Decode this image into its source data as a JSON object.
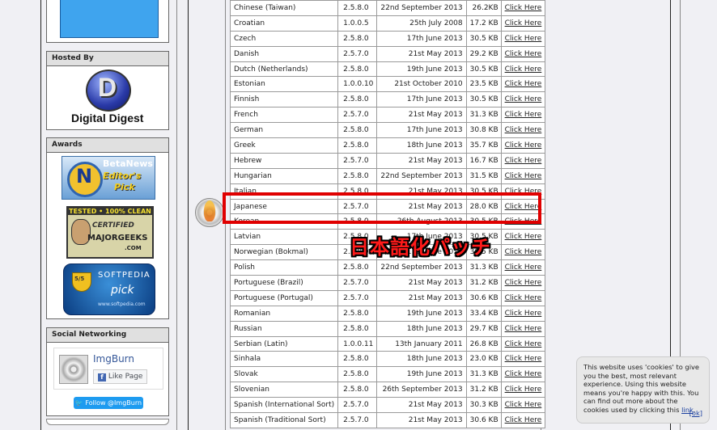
{
  "sidebar": {
    "hosted_by": {
      "title": "Hosted By",
      "logo_text": "Digital Digest",
      "logo_letter": "D"
    },
    "awards": {
      "title": "Awards",
      "badges": [
        {
          "top": "BetaNews",
          "line1": "Editor's",
          "line2": "Pick",
          "letter": "N"
        },
        {
          "top": "TESTED • 100% CLEAN",
          "line1": "CERTIFIED",
          "line2": "MAJORGEEKS",
          "line3": ".COM"
        },
        {
          "top": "SOFTPEDIA",
          "line1": "pick",
          "line2": "www.softpedia.com",
          "score": "5/5"
        }
      ]
    },
    "social": {
      "title": "Social Networking",
      "app_name": "ImgBurn",
      "like_label": "Like Page",
      "follow_label": "Follow @ImgBurn"
    }
  },
  "languages": [
    {
      "name": "Chinese (Taiwan)",
      "version": "2.5.8.0",
      "date": "22nd September 2013",
      "size": "26.2KB",
      "link": "Click Here"
    },
    {
      "name": "Croatian",
      "version": "1.0.0.5",
      "date": "25th July 2008",
      "size": "17.2 KB",
      "link": "Click Here"
    },
    {
      "name": "Czech",
      "version": "2.5.8.0",
      "date": "17th June 2013",
      "size": "30.5 KB",
      "link": "Click Here"
    },
    {
      "name": "Danish",
      "version": "2.5.7.0",
      "date": "21st May 2013",
      "size": "29.2 KB",
      "link": "Click Here"
    },
    {
      "name": "Dutch (Netherlands)",
      "version": "2.5.8.0",
      "date": "19th June 2013",
      "size": "30.5 KB",
      "link": "Click Here"
    },
    {
      "name": "Estonian",
      "version": "1.0.0.10",
      "date": "21st October 2010",
      "size": "23.5 KB",
      "link": "Click Here"
    },
    {
      "name": "Finnish",
      "version": "2.5.8.0",
      "date": "17th June 2013",
      "size": "30.5 KB",
      "link": "Click Here"
    },
    {
      "name": "French",
      "version": "2.5.7.0",
      "date": "21st May 2013",
      "size": "31.3 KB",
      "link": "Click Here"
    },
    {
      "name": "German",
      "version": "2.5.8.0",
      "date": "17th June 2013",
      "size": "30.8 KB",
      "link": "Click Here"
    },
    {
      "name": "Greek",
      "version": "2.5.8.0",
      "date": "18th June 2013",
      "size": "35.7 KB",
      "link": "Click Here"
    },
    {
      "name": "Hebrew",
      "version": "2.5.7.0",
      "date": "21st May 2013",
      "size": "16.7 KB",
      "link": "Click Here"
    },
    {
      "name": "Hungarian",
      "version": "2.5.8.0",
      "date": "22nd September 2013",
      "size": "31.5 KB",
      "link": "Click Here"
    },
    {
      "name": "Italian",
      "version": "2.5.8.0",
      "date": "21st May 2013",
      "size": "30.5 KB",
      "link": "Click Here"
    },
    {
      "name": "Japanese",
      "version": "2.5.7.0",
      "date": "21st May 2013",
      "size": "28.0 KB",
      "link": "Click Here"
    },
    {
      "name": "Korean",
      "version": "2.5.8.0",
      "date": "26th August 2013",
      "size": "30.5 KB",
      "link": "Click Here"
    },
    {
      "name": "Latvian",
      "version": "2.5.8.0",
      "date": "17th June 2013",
      "size": "30.5 KB",
      "link": "Click Here"
    },
    {
      "name": "Norwegian (Bokmal)",
      "version": "2.5.8.0",
      "date": "17th June 2013",
      "size": "30.5 KB",
      "link": "Click Here"
    },
    {
      "name": "Polish",
      "version": "2.5.8.0",
      "date": "22nd September 2013",
      "size": "31.3 KB",
      "link": "Click Here"
    },
    {
      "name": "Portuguese (Brazil)",
      "version": "2.5.7.0",
      "date": "21st May 2013",
      "size": "31.2 KB",
      "link": "Click Here"
    },
    {
      "name": "Portuguese (Portugal)",
      "version": "2.5.7.0",
      "date": "21st May 2013",
      "size": "30.6 KB",
      "link": "Click Here"
    },
    {
      "name": "Romanian",
      "version": "2.5.8.0",
      "date": "19th June 2013",
      "size": "33.4 KB",
      "link": "Click Here"
    },
    {
      "name": "Russian",
      "version": "2.5.8.0",
      "date": "18th June 2013",
      "size": "29.7 KB",
      "link": "Click Here"
    },
    {
      "name": "Serbian (Latin)",
      "version": "1.0.0.11",
      "date": "13th January 2011",
      "size": "26.8 KB",
      "link": "Click Here"
    },
    {
      "name": "Sinhala",
      "version": "2.5.8.0",
      "date": "18th June 2013",
      "size": "23.0 KB",
      "link": "Click Here"
    },
    {
      "name": "Slovak",
      "version": "2.5.8.0",
      "date": "19th June 2013",
      "size": "31.3 KB",
      "link": "Click Here"
    },
    {
      "name": "Slovenian",
      "version": "2.5.8.0",
      "date": "26th September 2013",
      "size": "31.2 KB",
      "link": "Click Here"
    },
    {
      "name": "Spanish (International Sort)",
      "version": "2.5.7.0",
      "date": "21st May 2013",
      "size": "30.3 KB",
      "link": "Click Here"
    },
    {
      "name": "Spanish (Traditional Sort)",
      "version": "2.5.7.0",
      "date": "21st May 2013",
      "size": "30.6 KB",
      "link": "Click Here"
    }
  ],
  "annotation": {
    "label": "日本語化パッチ",
    "color": "#ff1a1a"
  },
  "cookie": {
    "text": "This website uses 'cookies' to give you the best, most relevant experience. Using this website means you're happy with this. You can find out more about the cookies used by clicking this",
    "link_label": "link",
    "ok_label": "[ok]"
  },
  "colors": {
    "accent_blue": "#3fa4ee",
    "facebook_blue": "#4267b2",
    "twitter_blue": "#1d9bf0"
  }
}
